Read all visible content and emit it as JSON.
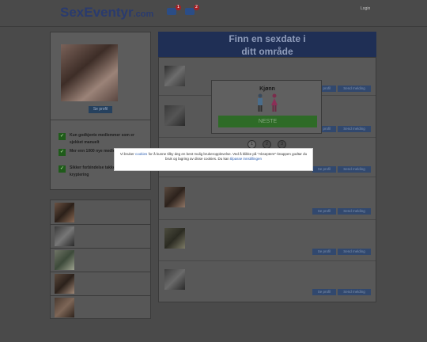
{
  "header": {
    "logo_main": "SexEventyr",
    "logo_domain": ".com",
    "icons": [
      {
        "name": "users-icon",
        "badge": "1"
      },
      {
        "name": "messages-icon",
        "badge": "2"
      }
    ],
    "login_label": "Login"
  },
  "sidebar": {
    "profile_button": "Se profil",
    "features": [
      "Kun godkjente medlemmer som er sjekket manuelt",
      "Mer enn 1000 nye medlemmer daglig",
      "Sikker forbindelse takket være SSL-kryptering"
    ],
    "list_count": 5
  },
  "main": {
    "title_line1": "Finn en sexdate i",
    "title_line2": "ditt område",
    "rows": [
      {
        "btn_profile": "Se profil",
        "btn_message": "Send melding"
      },
      {
        "btn_profile": "Se profil",
        "btn_message": "Send melding"
      },
      {
        "btn_profile": "Se profil",
        "btn_message": "Send melding"
      },
      {
        "btn_profile": "Se profil",
        "btn_message": "Send melding"
      },
      {
        "btn_profile": "Se profil",
        "btn_message": "Send melding"
      },
      {
        "btn_profile": "Se profil",
        "btn_message": "Send melding"
      }
    ]
  },
  "modal": {
    "title": "Kjønn",
    "next_button": "NESTE",
    "steps": [
      "1",
      "2",
      "3"
    ],
    "active_step": "1"
  },
  "cookie": {
    "text_before": "Vi bruker",
    "link_cookies": "cookies",
    "text_middle": "for å kunne tilby deg en best mulig brukeropplevelse. Ved å klikke på \"Akseptere\"-knappen godtar du bruk og lagring av disse cookies. Du kan",
    "link_settings": "tilpasse innstillingen"
  },
  "colors": {
    "brand": "#2a3b6e",
    "header_bg": "#1f2f55",
    "next_green": "#2e6b27",
    "badge_red": "#a51f24"
  }
}
